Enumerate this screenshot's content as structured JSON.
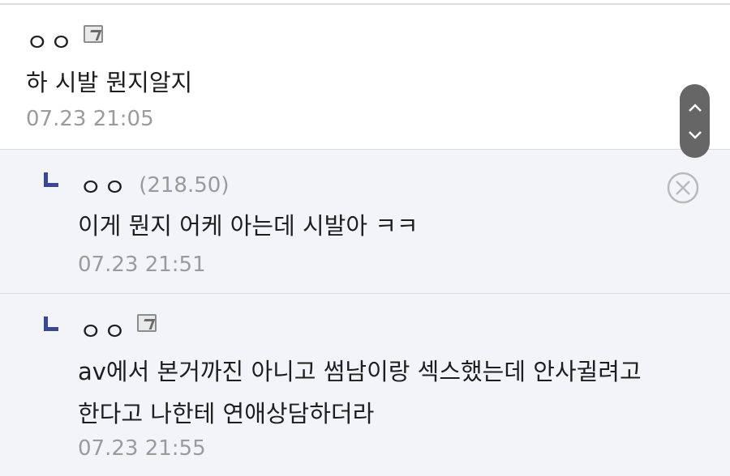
{
  "comments": [
    {
      "author": "ㅇㅇ",
      "text_lines": [
        "하 시발 뭔지알지"
      ],
      "time": "07.23 21:05"
    },
    {
      "author": "ㅇㅇ",
      "ip": "(218.50)",
      "text_lines": [
        "이게 뭔지 어케 아는데 시발아 ㅋㅋ"
      ],
      "time": "07.23 21:51"
    },
    {
      "author": "ㅇㅇ",
      "text_lines": [
        "av에서 본거까진 아니고 썸남이랑 섹스했는데 안사귈려고",
        "한다고 나한테 연애상담하더라"
      ],
      "time": "07.23 21:55"
    }
  ],
  "icons": {
    "fixed_user": "fixed-nickname-icon",
    "reply": "reply-arrow-icon",
    "delete": "delete-circle-x-icon",
    "scroll_up": "chevron-up-icon",
    "scroll_down": "chevron-down-icon"
  },
  "colors": {
    "reply_bg": "#f3f4f8",
    "reply_arrow": "#3b4890",
    "time_text": "#9b9b9b",
    "scroll_ctl": "#666666"
  }
}
